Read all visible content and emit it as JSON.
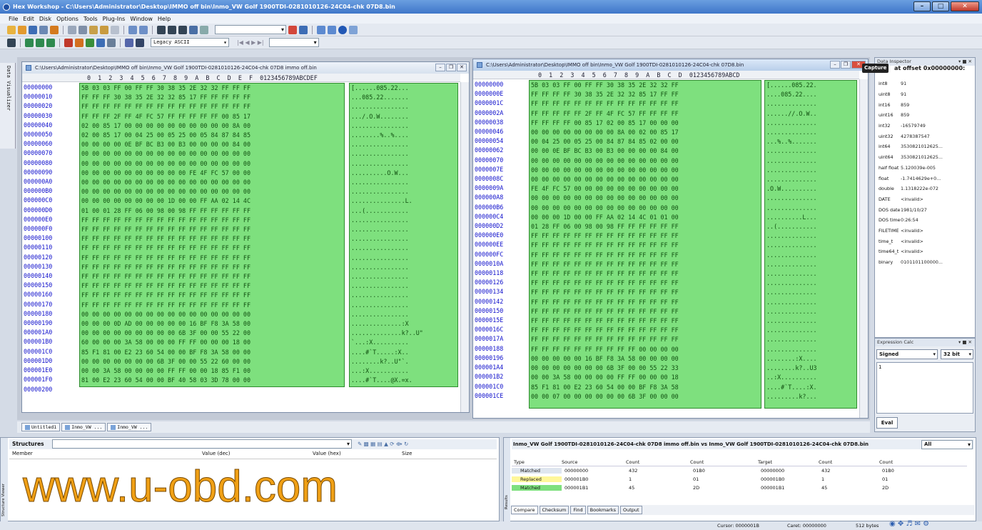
{
  "app": {
    "title": "Hex Workshop - C:\\Users\\Administrator\\Desktop\\IMMO off bin\\Inmo_VW Golf 1900TDI-0281010126-24C04-chk 07D8.bin"
  },
  "menu": [
    "File",
    "Edit",
    "Disk",
    "Options",
    "Tools",
    "Plug-Ins",
    "Window",
    "Help"
  ],
  "toolbar": {
    "encoding": "Legacy ASCII"
  },
  "sidebar_tab": "Data Visualizer",
  "left_window": {
    "title": "C:\\Users\\Administrator\\Desktop\\IMMO off bin\\Inmo_VW Golf 1900TDI-0281010126-24C04-chk 07D8 immo off.bin",
    "col_header": " 0  1  2  3  4  5  6  7  8  9  A  B  C  D  E  F  0123456789ABCDEF",
    "offsets": [
      "00000000",
      "00000010",
      "00000020",
      "00000030",
      "00000040",
      "00000050",
      "00000060",
      "00000070",
      "00000080",
      "00000090",
      "000000A0",
      "000000B0",
      "000000C0",
      "000000D0",
      "000000E0",
      "000000F0",
      "00000100",
      "00000110",
      "00000120",
      "00000130",
      "00000140",
      "00000150",
      "00000160",
      "00000170",
      "00000180",
      "00000190",
      "000001A0",
      "000001B0",
      "000001C0",
      "000001D0",
      "000001E0",
      "000001F0",
      "00000200"
    ],
    "hex": [
      "5B 03 03 FF 00 FF FF 30 38 35 2E 32 32 FF FF FF",
      "FF FF FF 30 38 35 2E 32 32 85 17 FF FF FF FF FF",
      "FF FF FF FF FF FF FF FF FF FF FF FF FF FF FF FF",
      "FF FF FF 2F FF 4F FC 57 FF FF FF FF FF 00 85 17",
      "02 00 85 17 00 00 00 00 00 00 00 00 00 00 8A 00",
      "02 00 85 17 00 04 25 00 05 25 00 05 84 87 84 85",
      "00 00 00 00 0E BF BC B3 00 B3 00 00 00 00 84 00",
      "00 00 00 00 00 00 00 00 00 00 00 00 00 00 00 00",
      "00 00 00 00 00 00 00 00 00 00 00 00 00 00 00 00",
      "00 00 00 00 00 00 00 00 00 00 FE 4F FC 57 00 00",
      "00 00 00 00 00 00 00 00 00 00 00 00 00 00 00 00",
      "00 00 00 00 00 00 00 00 00 00 00 00 00 00 00 00",
      "00 00 00 00 00 00 00 00 1D 00 00 FF AA 02 14 4C",
      "01 00 01 28 FF 06 00 98 00 98 FF FF FF FF FF FF",
      "FF FF FF FF FF FF FF FF FF FF FF FF FF FF FF FF",
      "FF FF FF FF FF FF FF FF FF FF FF FF FF FF FF FF",
      "FF FF FF FF FF FF FF FF FF FF FF FF FF FF FF FF",
      "FF FF FF FF FF FF FF FF FF FF FF FF FF FF FF FF",
      "FF FF FF FF FF FF FF FF FF FF FF FF FF FF FF FF",
      "FF FF FF FF FF FF FF FF FF FF FF FF FF FF FF FF",
      "FF FF FF FF FF FF FF FF FF FF FF FF FF FF FF FF",
      "FF FF FF FF FF FF FF FF FF FF FF FF FF FF FF FF",
      "FF FF FF FF FF FF FF FF FF FF FF FF FF FF FF FF",
      "FF FF FF FF FF FF FF FF FF FF FF FF FF FF FF FF",
      "00 00 00 00 00 00 00 00 00 00 00 00 00 00 00 00",
      "00 00 00 0D AD 00 00 00 00 00 16 BF F8 3A 58 00",
      "00 00 00 00 00 00 00 00 00 6B 3F 00 00 55 22 00",
      "60 00 00 00 3A 58 00 00 00 FF FF 00 00 00 18 00",
      "85 F1 81 00 E2 23 60 54 00 00 BF F8 3A 58 00 00",
      "00 00 00 00 00 00 00 6B 3F 00 00 55 22 60 00 00",
      "00 00 3A 58 00 00 00 00 FF FF 00 00 18 85 F1 00",
      "81 00 E2 23 60 54 00 00 BF 40 58 03 3D 78 00 00",
      ""
    ],
    "ascii": [
      "[......085.22...",
      "...085.22.......",
      "................",
      ".../.O.W........",
      "................",
      "........%..%....",
      "................",
      "................",
      "................",
      "..........O.W...",
      "................",
      "................",
      "...............L.",
      "...(............",
      "................",
      "................",
      "................",
      "................",
      "................",
      "................",
      "................",
      "................",
      "................",
      "................",
      "................",
      "..............:X",
      "..............k?..U\"",
      "`...:X..........",
      "....#`T.....:X..",
      "........k?..U\"`.",
      "...:X...........",
      "....#`T....@X.=x.",
      ""
    ]
  },
  "right_window": {
    "title": "C:\\Users\\Administrator\\Desktop\\IMMO off bin\\Inmo_VW Golf 1900TDI-0281010126-24C04-chk 07D8.bin",
    "col_header": " 0  1  2  3  4  5  6  7  8  9  A  B  C  D  0123456789ABCD",
    "offsets": [
      "00000000",
      "0000000E",
      "0000001C",
      "0000002A",
      "00000038",
      "00000046",
      "00000054",
      "00000062",
      "00000070",
      "0000007E",
      "0000008C",
      "0000009A",
      "000000A8",
      "000000B6",
      "000000C4",
      "000000D2",
      "000000E0",
      "000000EE",
      "000000FC",
      "0000010A",
      "00000118",
      "00000126",
      "00000134",
      "00000142",
      "00000150",
      "0000015E",
      "0000016C",
      "0000017A",
      "00000188",
      "00000196",
      "000001A4",
      "000001B2",
      "000001C0",
      "000001CE"
    ],
    "hex": [
      "5B 03 03 FF 00 FF FF 30 38 35 2E 32 32 FF",
      "FF FF FF FF 30 38 35 2E 32 32 85 17 FF FF",
      "FF FF FF FF FF FF FF FF FF FF FF FF FF FF",
      "FF FF FF FF FF 2F FF 4F FC 57 FF FF FF FF",
      "FF FF FF FF 00 85 17 02 00 85 17 00 00 00",
      "00 00 00 00 00 00 00 00 8A 00 02 00 85 17",
      "00 04 25 00 05 25 00 84 87 84 85 02 00 00",
      "00 00 0E BF BC B3 00 B3 00 00 00 00 84 00",
      "00 00 00 00 00 00 00 00 00 00 00 00 00 00",
      "00 00 00 00 00 00 00 00 00 00 00 00 00 00",
      "00 00 00 00 00 00 00 00 00 00 00 00 00 00",
      "FE 4F FC 57 00 00 00 00 00 00 00 00 00 00",
      "00 00 00 00 00 00 00 00 00 00 00 00 00 00",
      "00 00 00 00 00 00 00 00 00 00 00 00 00 00",
      "00 00 00 1D 00 00 FF AA 02 14 4C 01 01 00",
      "01 28 FF 06 00 98 00 98 FF FF FF FF FF FF",
      "FF FF FF FF FF FF FF FF FF FF FF FF FF FF",
      "FF FF FF FF FF FF FF FF FF FF FF FF FF FF",
      "FF FF FF FF FF FF FF FF FF FF FF FF FF FF",
      "FF FF FF FF FF FF FF FF FF FF FF FF FF FF",
      "FF FF FF FF FF FF FF FF FF FF FF FF FF FF",
      "FF FF FF FF FF FF FF FF FF FF FF FF FF FF",
      "FF FF FF FF FF FF FF FF FF FF FF FF FF FF",
      "FF FF FF FF FF FF FF FF FF FF FF FF FF FF",
      "FF FF FF FF FF FF FF FF FF FF FF FF FF FF",
      "FF FF FF FF FF FF FF FF FF FF FF FF FF FF",
      "FF FF FF FF FF FF FF FF FF FF FF FF FF FF",
      "FF FF FF FF FF FF FF FF FF FF FF FF FF FF",
      "FF FF FF FF FF FF FF FF FF FF 00 00 00 00",
      "00 00 00 00 00 16 BF F8 3A 58 00 00 00 00",
      "00 00 00 00 00 00 00 6B 3F 00 00 55 22 33",
      "00 00 3A 58 00 00 00 00 FF FF 00 00 00 18",
      "85 F1 81 00 E2 23 60 54 00 00 BF F8 3A 58",
      "00 00 07 00 00 00 00 00 00 6B 3F 00 00 00"
    ],
    "ascii": [
      "[......085.22.",
      "....085.22....",
      "..............",
      "......//.O.W..",
      "..............",
      "..............",
      "...%..%.......",
      "..............",
      "..............",
      "..............",
      "..............",
      ".O.W..........",
      "..............",
      "..............",
      "..........L...",
      "..(...........",
      "..............",
      "..............",
      "..............",
      "..............",
      "..............",
      "..............",
      "..............",
      "..............",
      "..............",
      "..............",
      "..............",
      "..............",
      "..............",
      "........:X....",
      "........k?..U3",
      "..:X..........",
      "....#`T....:X.",
      ".........k?..."
    ]
  },
  "inspector": {
    "title": "Data Inspector",
    "capture": "Capture",
    "offset_label": "at offset 0x00000000:",
    "rows": [
      {
        "k": "int8",
        "v": "91"
      },
      {
        "k": "uint8",
        "v": "91"
      },
      {
        "k": "int16",
        "v": "859"
      },
      {
        "k": "uint16",
        "v": "859"
      },
      {
        "k": "int32",
        "v": "-16579749"
      },
      {
        "k": "uint32",
        "v": "4278387547"
      },
      {
        "k": "int64",
        "v": "3530821012625..."
      },
      {
        "k": "uint64",
        "v": "3530821012625..."
      },
      {
        "k": "half float",
        "v": "5.120039e-005"
      },
      {
        "k": "float",
        "v": "-1.7414629e+0..."
      },
      {
        "k": "double",
        "v": "1.1318222e-072"
      },
      {
        "k": "DATE",
        "v": "<invalid>"
      },
      {
        "k": "DOS date",
        "v": "1981/10/27"
      },
      {
        "k": "DOS time",
        "v": "0:26:54"
      },
      {
        "k": "FILETIME",
        "v": "<invalid>"
      },
      {
        "k": "time_t",
        "v": "<invalid>"
      },
      {
        "k": "time64_t",
        "v": "<invalid>"
      },
      {
        "k": "binary",
        "v": "0101101100000..."
      }
    ]
  },
  "expr": {
    "title": "Expression Calc",
    "mode": "Signed",
    "bits": "32 bit",
    "input": "1",
    "eval": "Eval"
  },
  "doc_tabs": [
    "Untitled1",
    "Inmo_VW ...",
    "Inmo_VW ..."
  ],
  "structures": {
    "title": "Structures",
    "headers": [
      "Member",
      "Value (dec)",
      "Value (hex)",
      "Size"
    ],
    "side": "Structure Viewer"
  },
  "watermark": "www.u-obd.com",
  "compare": {
    "title": "Inmo_VW Golf 1900TDI-0281010126-24C04-chk 07D8 immo off.bin vs Inmo_VW Golf 1900TDI-0281010126-24C04-chk 07D8.bin",
    "filter": "All",
    "headers": [
      "Type",
      "Source",
      "Count",
      "Count",
      "Target",
      "Count",
      "Count"
    ],
    "rows": [
      {
        "type": "Matched",
        "src": "00000000",
        "c1": "432",
        "c2": "01B0",
        "tgt": "00000000",
        "c3": "432",
        "c4": "01B0",
        "color": "#dfe6ef"
      },
      {
        "type": "Replaced",
        "src": "000001B0",
        "c1": "1",
        "c2": "01",
        "tgt": "000001B0",
        "c3": "1",
        "c4": "01",
        "color": "#fff79a"
      },
      {
        "type": "Matched",
        "src": "000001B1",
        "c1": "45",
        "c2": "2D",
        "tgt": "000001B1",
        "c3": "45",
        "c4": "2D",
        "color": "#7ee07e"
      }
    ],
    "tabs": [
      "Compare",
      "Checksum",
      "Find",
      "Bookmarks",
      "Output"
    ],
    "side": "Results"
  },
  "status": {
    "cursor": "Cursor: 0000001B",
    "caret": "Caret: 00000000",
    "size": "512 bytes"
  }
}
